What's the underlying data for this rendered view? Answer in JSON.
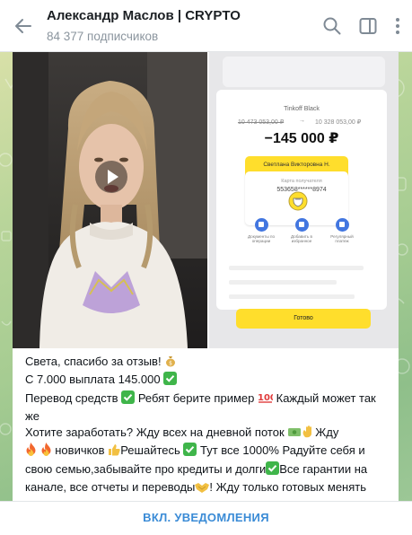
{
  "header": {
    "title": "Александр Маслов | CRYPTO",
    "subscribers": "84 377 подписчиков",
    "icons": [
      "back-arrow-icon",
      "search-icon",
      "side-panel-icon",
      "more-icon"
    ]
  },
  "receipt": {
    "bank": "Tinkoff Black",
    "balance_old": "10 473 053,00 ₽",
    "balance_new": "10 328 053,00 ₽",
    "amount": "−145 000 ₽",
    "recipient": "Светлана Викторовна Н.",
    "card_label": "Карта получателя",
    "card_number": "553658******8974",
    "actions": [
      "Документы по операции",
      "Добавить в избранное",
      "Регулярный платеж"
    ],
    "done_label": "Готово",
    "accent": "#ffde2c"
  },
  "message": {
    "lines": [
      "Света, спасибо за отзыв!",
      "С 7.000 выплата 145.000",
      "Перевод средств",
      "Ребят берите пример",
      "Каждый может так же",
      "Хотите заработать? Жду всех на дневной поток",
      "Жду",
      "новичков",
      "Решайтесь",
      "Тут все 1000% Радуйте себя и свою семью,забывайте про кредиты и долги",
      "Все гарантии на канале, все отчеты и переводы",
      "! Жду только готовых менять жизнь!  Сегодня нужно по максимуму"
    ]
  },
  "bottom": {
    "notify_label": "ВКЛ. УВЕДОМЛЕНИЯ"
  },
  "colors": {
    "accent": "#3a8bd6",
    "check_green": "#3fb54a",
    "money_yellow": "#f3b93a"
  }
}
